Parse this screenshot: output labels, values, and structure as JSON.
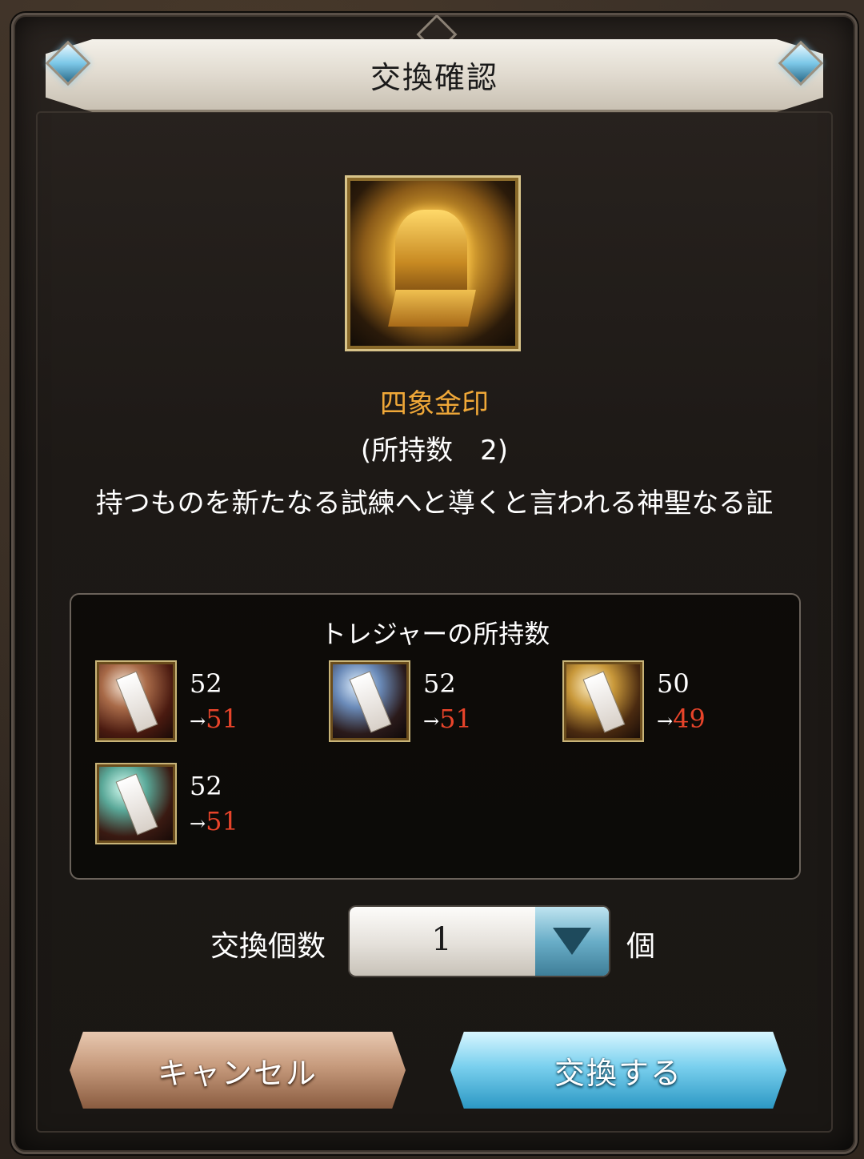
{
  "dialog": {
    "title": "交換確認"
  },
  "item": {
    "name": "四象金印",
    "owned_text": "(所持数　2)",
    "description": "持つものを新たなる試練へと導くと言われる神聖なる証"
  },
  "treasure": {
    "title": "トレジャーの所持数",
    "items": [
      {
        "icon": "red-talisman-icon",
        "before": "52",
        "after": "51"
      },
      {
        "icon": "blue-talisman-icon",
        "before": "52",
        "after": "51"
      },
      {
        "icon": "gold-talisman-icon",
        "before": "50",
        "after": "49"
      },
      {
        "icon": "teal-talisman-icon",
        "before": "52",
        "after": "51"
      }
    ],
    "arrow": "→"
  },
  "quantity": {
    "label": "交換個数",
    "value": "1",
    "unit": "個"
  },
  "buttons": {
    "cancel_label": "キャンセル",
    "exchange_label": "交換する"
  },
  "colors": {
    "item_name": "#f0a838",
    "after_value": "#e8442a",
    "accent_blue": "#7ad0ee",
    "accent_brown": "#c69a7c"
  }
}
